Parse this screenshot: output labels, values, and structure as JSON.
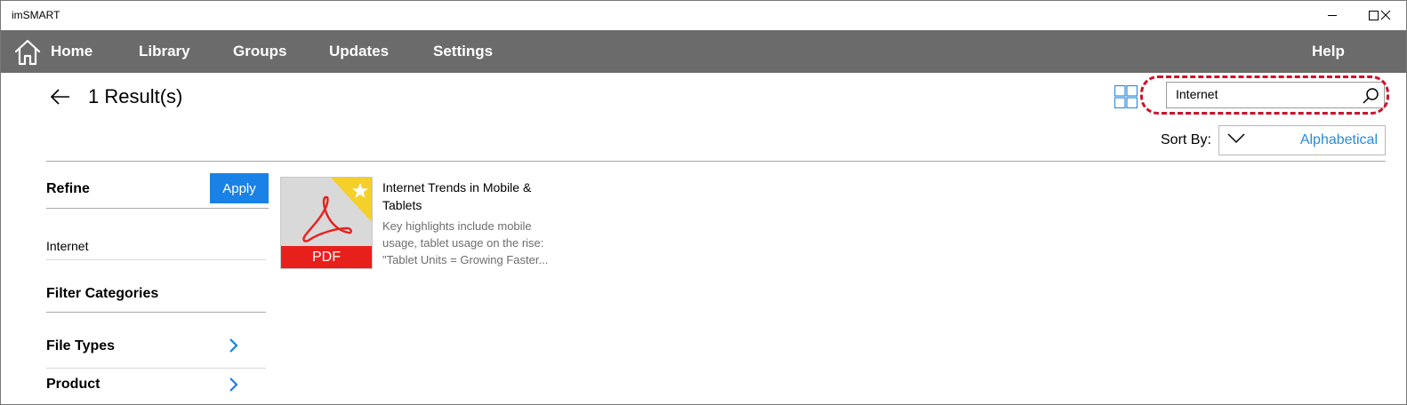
{
  "window": {
    "title": "imSMART"
  },
  "nav": {
    "home": "Home",
    "library": "Library",
    "groups": "Groups",
    "updates": "Updates",
    "settings": "Settings",
    "help": "Help"
  },
  "results": {
    "count_label": "1 Result(s)"
  },
  "search": {
    "value": "Internet",
    "placeholder": ""
  },
  "sort": {
    "label": "Sort By:",
    "value": "Alphabetical"
  },
  "refine": {
    "title": "Refine",
    "apply_label": "Apply",
    "active_filter": "Internet"
  },
  "filters": {
    "title": "Filter Categories",
    "facets": [
      {
        "label": "File Types"
      },
      {
        "label": "Product"
      }
    ]
  },
  "result_item": {
    "title": "Internet Trends in Mobile & Tablets",
    "description": "Key highlights include mobile usage, tablet usage on the rise: \"Tablet Units = Growing Faster...",
    "file_type": "PDF",
    "favorite": true,
    "icon": "pdf-acrobat-icon"
  },
  "colors": {
    "nav_bg": "#6b6b6b",
    "accent": "#1a82e6",
    "sort_value": "#2a8ae0",
    "pdf_red": "#e8201c",
    "favorite_yellow": "#f5cf2a",
    "highlight": "#d0102a"
  }
}
